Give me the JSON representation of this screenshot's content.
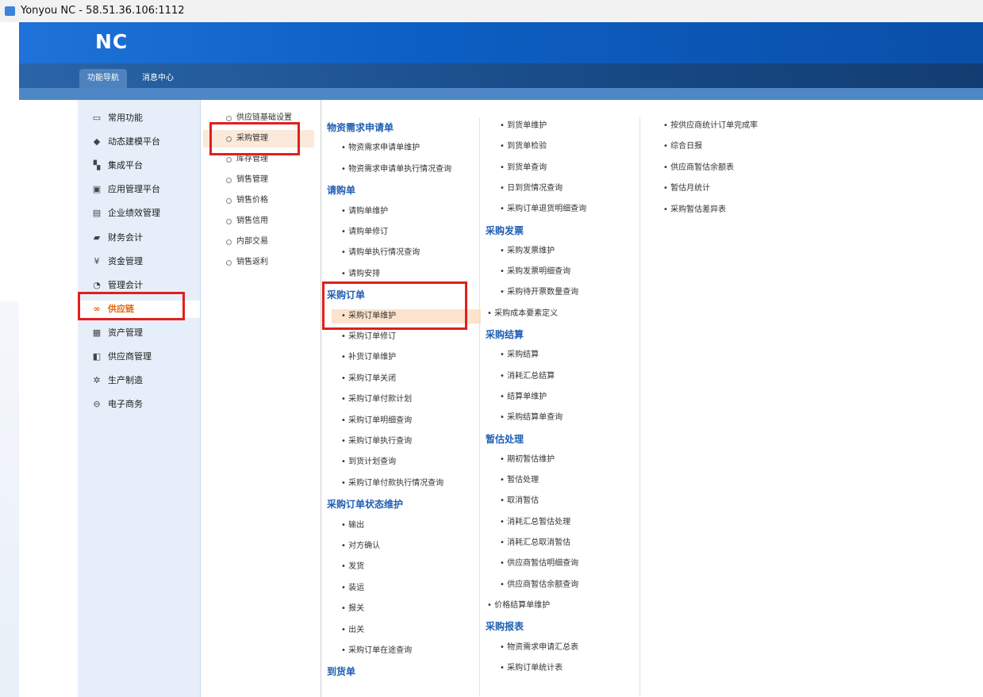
{
  "window": {
    "title": "Yonyou NC - 58.51.36.106:1112"
  },
  "brand": {
    "logo": "NC"
  },
  "tabs": [
    {
      "label": "功能导航",
      "active": true
    },
    {
      "label": "消息中心",
      "active": false
    }
  ],
  "sidebar": {
    "items": [
      {
        "icon": "monitor-icon",
        "glyph": "▭",
        "label": "常用功能"
      },
      {
        "icon": "cube-icon",
        "glyph": "◆",
        "label": "动态建模平台"
      },
      {
        "icon": "grid-icon",
        "glyph": "▚",
        "label": "集成平台"
      },
      {
        "icon": "window-icon",
        "glyph": "▣",
        "label": "应用管理平台"
      },
      {
        "icon": "table-icon",
        "glyph": "▤",
        "label": "企业绩效管理"
      },
      {
        "icon": "ledger-icon",
        "glyph": "▰",
        "label": "财务会计"
      },
      {
        "icon": "yen-icon",
        "glyph": "¥",
        "label": "资金管理"
      },
      {
        "icon": "clock-icon",
        "glyph": "◔",
        "label": "管理会计"
      },
      {
        "icon": "link-icon",
        "glyph": "∞",
        "label": "供应链",
        "active": true
      },
      {
        "icon": "assets-icon",
        "glyph": "▦",
        "label": "资产管理"
      },
      {
        "icon": "supplier-icon",
        "glyph": "◧",
        "label": "供应商管理"
      },
      {
        "icon": "gear-icon",
        "glyph": "✲",
        "label": "生产制造"
      },
      {
        "icon": "ecommerce-icon",
        "glyph": "⊖",
        "label": "电子商务"
      }
    ]
  },
  "submenu": {
    "items": [
      {
        "label": "供应链基础设置"
      },
      {
        "label": "采购管理",
        "active": true
      },
      {
        "label": "库存管理"
      },
      {
        "label": "销售管理"
      },
      {
        "label": "销售价格"
      },
      {
        "label": "销售信用"
      },
      {
        "label": "内部交易"
      },
      {
        "label": "销售返利"
      }
    ]
  },
  "columns": {
    "col1": [
      {
        "text": "物资需求申请单",
        "type": "head"
      },
      {
        "text": "• 物资需求申请单维护"
      },
      {
        "text": "• 物资需求申请单执行情况查询"
      },
      {
        "text": "请购单",
        "type": "head"
      },
      {
        "text": "• 请购单维护"
      },
      {
        "text": "• 请购单修订"
      },
      {
        "text": "• 请购单执行情况查询"
      },
      {
        "text": "• 请购安排"
      },
      {
        "text": "采购订单",
        "type": "head"
      },
      {
        "text": "• 采购订单维护",
        "selected": true
      },
      {
        "text": "• 采购订单修订"
      },
      {
        "text": "• 补货订单维护"
      },
      {
        "text": "• 采购订单关闭"
      },
      {
        "text": "• 采购订单付款计划"
      },
      {
        "text": "• 采购订单明细查询"
      },
      {
        "text": "• 采购订单执行查询"
      },
      {
        "text": "• 到货计划查询"
      },
      {
        "text": "• 采购订单付款执行情况查询"
      },
      {
        "text": "采购订单状态维护",
        "type": "head"
      },
      {
        "text": "• 输出"
      },
      {
        "text": "• 对方确认"
      },
      {
        "text": "• 发货"
      },
      {
        "text": "• 装运"
      },
      {
        "text": "• 报关"
      },
      {
        "text": "• 出关"
      },
      {
        "text": "• 采购订单在途查询"
      },
      {
        "text": "到货单",
        "type": "head"
      }
    ],
    "col2": [
      {
        "text": "• 到货单维护"
      },
      {
        "text": "• 到货单检验"
      },
      {
        "text": "• 到货单查询"
      },
      {
        "text": "• 日到货情况查询"
      },
      {
        "text": "• 采购订单退货明细查询"
      },
      {
        "text": "采购发票",
        "type": "head"
      },
      {
        "text": "• 采购发票维护"
      },
      {
        "text": "• 采购发票明细查询"
      },
      {
        "text": "• 采购待开票数量查询"
      },
      {
        "text": "• 采购成本要素定义",
        "outdent": true
      },
      {
        "text": "采购结算",
        "type": "head"
      },
      {
        "text": "• 采购结算"
      },
      {
        "text": "• 消耗汇总结算"
      },
      {
        "text": "• 结算单维护"
      },
      {
        "text": "• 采购结算单查询"
      },
      {
        "text": "暂估处理",
        "type": "head"
      },
      {
        "text": "• 期初暂估维护"
      },
      {
        "text": "• 暂估处理"
      },
      {
        "text": "• 取消暂估"
      },
      {
        "text": "• 消耗汇总暂估处理"
      },
      {
        "text": "• 消耗汇总取消暂估"
      },
      {
        "text": "• 供应商暂估明细查询"
      },
      {
        "text": "• 供应商暂估余额查询"
      },
      {
        "text": "• 价格结算单维护",
        "outdent": true
      },
      {
        "text": "采购报表",
        "type": "head"
      },
      {
        "text": "• 物资需求申请汇总表"
      },
      {
        "text": "• 采购订单统计表"
      }
    ],
    "col3": [
      {
        "text": "• 按供应商统计订单完成率"
      },
      {
        "text": "• 综合日报"
      },
      {
        "text": "• 供应商暂估余额表"
      },
      {
        "text": "• 暂估月统计"
      },
      {
        "text": "• 采购暂估差异表"
      }
    ]
  }
}
